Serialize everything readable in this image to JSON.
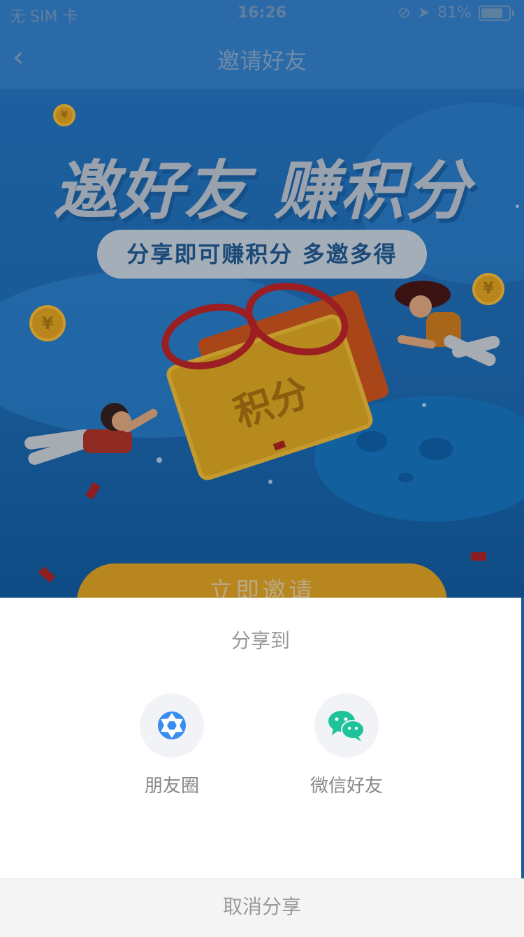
{
  "status_bar": {
    "carrier": "无 SIM 卡",
    "time": "16:26",
    "battery": "81%"
  },
  "nav": {
    "back_glyph": "‹",
    "title": "邀请好友"
  },
  "hero": {
    "headline": "邀好友 赚积分",
    "subtitle": "分享即可赚积分 多邀多得",
    "ticket_label": "积分",
    "coin_glyph": "¥",
    "invite_button": "立即邀请"
  },
  "share_sheet": {
    "title": "分享到",
    "options": [
      {
        "label": "朋友圈",
        "icon": "moments-shutter-icon",
        "color": "#3a8df0"
      },
      {
        "label": "微信好友",
        "icon": "wechat-icon",
        "color": "#1fc39a"
      }
    ],
    "cancel_label": "取消分享"
  }
}
